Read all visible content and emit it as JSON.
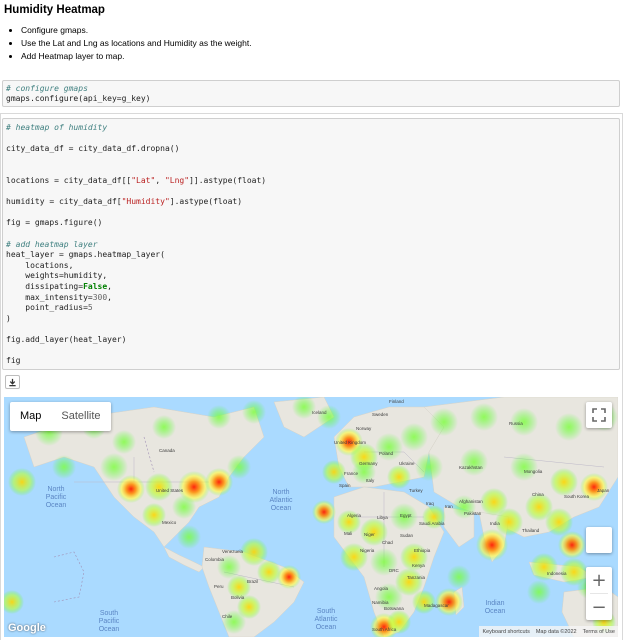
{
  "markdown": {
    "heading": "Humidity Heatmap",
    "bullets": [
      "Configure gmaps.",
      "Use the Lat and Lng as locations and Humidity as the weight.",
      "Add Heatmap layer to map."
    ]
  },
  "cell1": {
    "comment": "# configure gmaps",
    "line": "gmaps.configure(api_key=g_key)"
  },
  "cell2": {
    "comment1": "# heatmap of humidity",
    "line1": "city_data_df = city_data_df.dropna()",
    "line2a": "locations = city_data_df[[",
    "str_lat": "\"Lat\"",
    "sep": ", ",
    "str_lng": "\"Lng\"",
    "line2b": "]].astype(float)",
    "line3a": "humidity = city_data_df[",
    "str_hum": "\"Humidity\"",
    "line3b": "].astype(float)",
    "line4": "fig = gmaps.figure()",
    "comment2": "# add heatmap layer",
    "line5": "heat_layer = gmaps.heatmap_layer(",
    "arg1": "    locations,",
    "arg2": "    weights=humidity,",
    "arg3a": "    dissipating=",
    "kw_false": "False",
    "arg3b": ",",
    "arg4a": "    max_intensity=",
    "num300": "300",
    "arg4b": ",",
    "arg5a": "    point_radius=",
    "num5": "5",
    "close": ")",
    "line6": "fig.add_layer(heat_layer)",
    "line7": "fig"
  },
  "map": {
    "tab_map": "Map",
    "tab_satellite": "Satellite",
    "zoom_in": "+",
    "zoom_out": "−",
    "logo": "Google",
    "attrib": {
      "shortcuts": "Keyboard shortcuts",
      "mapdata": "Map data ©2022",
      "terms": "Terms of Use"
    },
    "labels": {
      "finland": "Finland",
      "sweden": "Sweden",
      "norway": "Norway",
      "iceland": "Iceland",
      "russia": "Russia",
      "uk": "United Kingdom",
      "poland": "Poland",
      "germany": "Germany",
      "france": "France",
      "ukraine": "Ukraine",
      "spain": "Spain",
      "italy": "Italy",
      "kazakhstan": "Kazakhstan",
      "mongolia": "Mongolia",
      "china": "China",
      "south_korea": "South Korea",
      "japan": "Japan",
      "turkey": "Turkey",
      "afghanistan": "Afghanistan",
      "iraq": "Iraq",
      "iran": "Iran",
      "pakistan": "Pakistan",
      "india": "India",
      "thailand": "Thailand",
      "canada": "Canada",
      "united_states": "United States",
      "mexico": "Mexico",
      "north_atlantic": "North\nAtlantic\nOcean",
      "north_pacific": "North\nPacific\nOcean",
      "algeria": "Algeria",
      "libya": "Libya",
      "egypt": "Egypt",
      "saudi": "Saudi Arabia",
      "mali": "Mali",
      "niger": "Niger",
      "chad": "Chad",
      "sudan": "Sudan",
      "nigeria": "Nigeria",
      "ethiopia": "Ethiopia",
      "drc": "DRC",
      "kenya": "Kenya",
      "tanzania": "Tanzania",
      "angola": "Angola",
      "namibia": "Namibia",
      "botswana": "Botswana",
      "madagascar": "Madagascar",
      "south_africa": "South Africa",
      "venezuela": "Venezuela",
      "colombia": "Colombia",
      "peru": "Peru",
      "brazil": "Brazil",
      "bolivia": "Bolivia",
      "chile": "Chile",
      "south_pacific": "South\nPacific\nOcean",
      "south_atlantic": "South\nAtlantic\nOcean",
      "indian": "Indian\nOcean",
      "indonesia": "Indonesia"
    }
  },
  "colors": {
    "ocean": "#aadaff",
    "land": "#e8e6df",
    "ocean_label": "#5b86c4",
    "comment": "#408080",
    "string": "#ba2121",
    "keyword": "#008000"
  },
  "icons": {
    "download": "download-icon",
    "fullscreen": "fullscreen-icon",
    "pegman": "pegman-icon"
  }
}
